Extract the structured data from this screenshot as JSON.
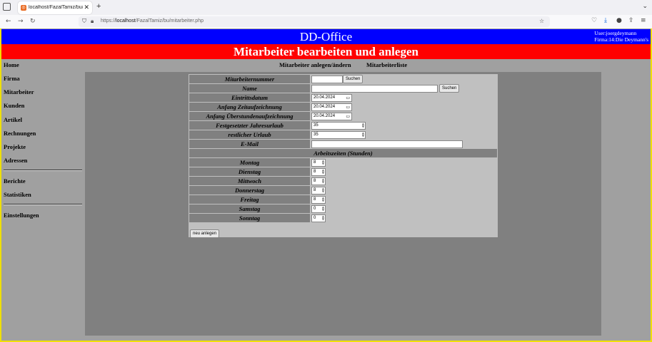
{
  "browser": {
    "tab_title": "localhost/FazalTamiz/bu/mitarb",
    "new_tab": "+",
    "url_host": "localhost",
    "url_path": "/FazalTamiz/bu/mitarbeiter.php",
    "url_prefix": "https://"
  },
  "header": {
    "app_title": "DD-Office",
    "user_line": "User:joergdeymann",
    "firma_line": "Firma:14:Die Deymann's",
    "page_title": "Mitarbeiter bearbeiten und anlegen"
  },
  "sidebar": {
    "items": [
      "Home",
      "Firma",
      "Mitarbeiter",
      "Kunden",
      "Artikel",
      "Rechnungen",
      "Projekte",
      "Adressen",
      "Berichte",
      "Statistiken",
      "Einstellungen"
    ]
  },
  "topnav": {
    "link1": "Mitarbeiter anlegen/ändern",
    "link2": "Mitarbeiterliste"
  },
  "form": {
    "mitarbeiternummer_label": "Mitarbeiternummer",
    "name_label": "Name",
    "eintrittsdatum_label": "Eintrittsdatum",
    "zeitaufzeichnung_label": "Anfang Zeitaufzeichnung",
    "ueberstunden_label": "Anfang Überstundenaufzeichnung",
    "jahresurlaub_label": "Festgesetzter Jahresurlaub",
    "resturlaub_label": "restlicher Urlaub",
    "email_label": "E-Mail",
    "search_button": "Suchen",
    "eintrittsdatum_value": "20.04.2024",
    "zeitaufzeichnung_value": "20.04.2024",
    "ueberstunden_value": "20.04.2024",
    "jahresurlaub_value": "35",
    "resturlaub_value": "35",
    "arbeitszeiten_header": "Arbeitszeiten (Stunden)",
    "days": [
      {
        "label": "Montag",
        "value": "8"
      },
      {
        "label": "Dienstag",
        "value": "8"
      },
      {
        "label": "Mittwoch",
        "value": "8"
      },
      {
        "label": "Donnerstag",
        "value": "8"
      },
      {
        "label": "Freitag",
        "value": "8"
      },
      {
        "label": "Samstag",
        "value": "0"
      },
      {
        "label": "Sonntag",
        "value": "0"
      }
    ],
    "submit_button": "neu anlegen"
  }
}
